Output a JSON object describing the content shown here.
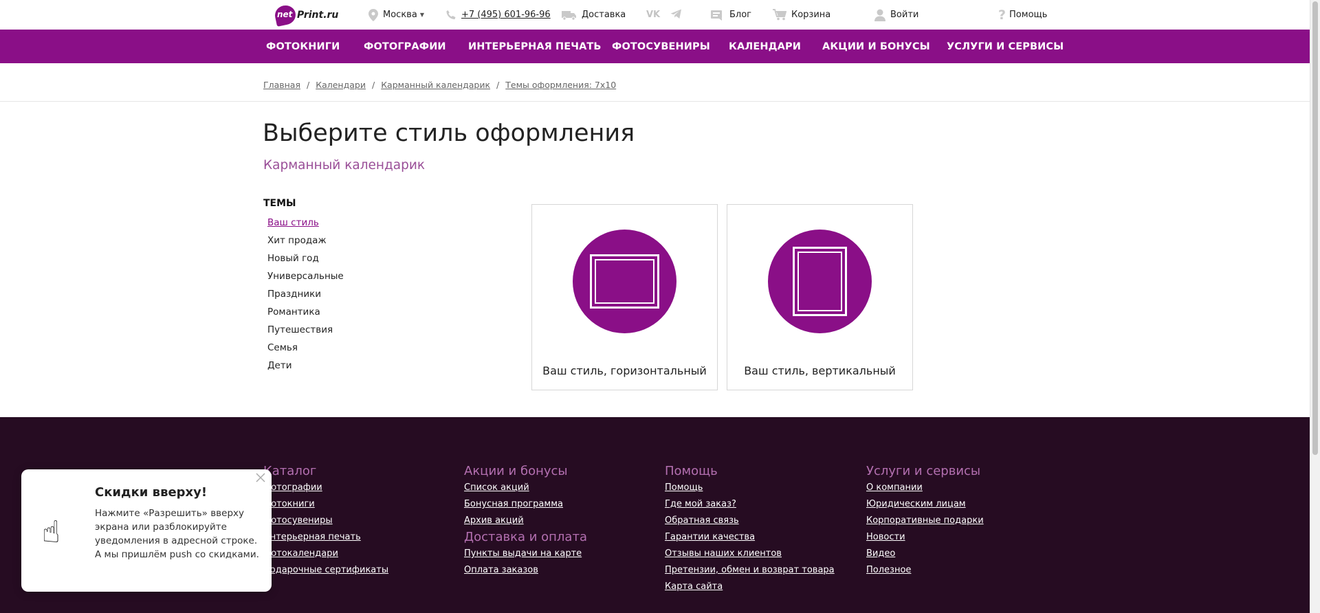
{
  "topbar": {
    "logo_net": "net",
    "logo_print": "Print.ru",
    "city": "Москва",
    "phone": "+7 (495) 601-96-96",
    "delivery": "Доставка",
    "social_vk": "VK",
    "blog": "Блог",
    "cart": "Корзина",
    "login": "Войти",
    "help": "Помощь"
  },
  "nav": {
    "items": [
      "ФОТОКНИГИ",
      "ФОТОГРАФИИ",
      "ИНТЕРЬЕРНАЯ ПЕЧАТЬ",
      "ФОТОСУВЕНИРЫ",
      "КАЛЕНДАРИ",
      "АКЦИИ И БОНУСЫ",
      "УСЛУГИ И СЕРВИСЫ"
    ]
  },
  "breadcrumb": {
    "items": [
      "Главная",
      "Календари",
      "Карманный календарик",
      "Темы оформления: 7х10"
    ],
    "separator": "/"
  },
  "main": {
    "title": "Выберите стиль оформления",
    "subtitle": "Карманный календарик",
    "themes_heading": "ТЕМЫ",
    "themes": [
      "Ваш стиль",
      "Хит продаж",
      "Новый год",
      "Универсальные",
      "Праздники",
      "Романтика",
      "Путешествия",
      "Семья",
      "Дети"
    ],
    "cards": [
      {
        "label": "Ваш стиль, горизонтальный"
      },
      {
        "label": "Ваш стиль, вертикальный"
      }
    ]
  },
  "footer": {
    "catalog": {
      "title": "Каталог",
      "links": [
        "Фотографии",
        "Фотокниги",
        "Фотосувениры",
        "Интерьерная печать",
        "Фотокалендари",
        "Подарочные сертификаты"
      ]
    },
    "promo": {
      "title": "Акции и бонусы",
      "links": [
        "Список акций",
        "Бонусная программа",
        "Архив акций"
      ]
    },
    "delivery": {
      "title": "Доставка и оплата",
      "links": [
        "Пункты выдачи на карте",
        "Оплата заказов"
      ]
    },
    "help": {
      "title": "Помощь",
      "links": [
        "Помощь",
        "Где мой заказ?",
        "Обратная связь",
        "Гарантии качества",
        "Отзывы наших клиентов",
        "Претензии, обмен и возврат товара",
        "Карта сайта"
      ]
    },
    "services": {
      "title": "Услуги и сервисы",
      "links": [
        "О компании",
        "Юридическим лицам",
        "Корпоративные подарки",
        "Новости",
        "Видео",
        "Полезное"
      ]
    }
  },
  "popup": {
    "title": "Скидки вверху!",
    "text": "Нажмите «Разрешить» вверху экрана или разблокируйте уведомления в адресной строке. А мы пришлём push со скидками.",
    "icon": "☝"
  },
  "colors": {
    "brand": "#8a0f87",
    "footer_bg": "#260c22",
    "accent_text": "#9a4f98"
  }
}
